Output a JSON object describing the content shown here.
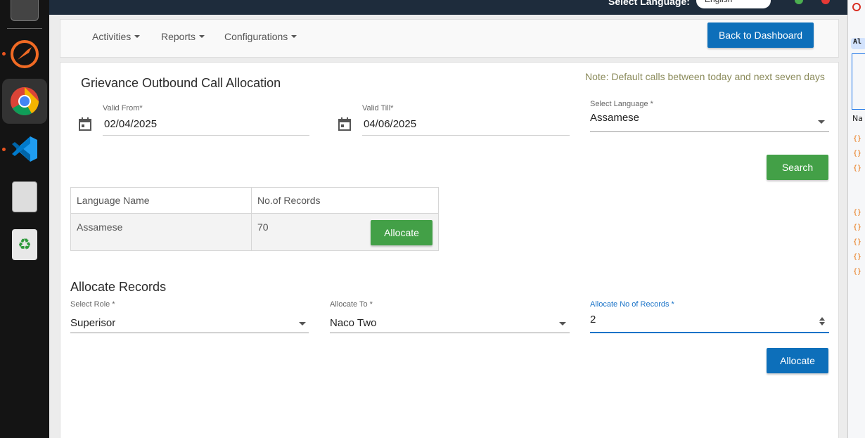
{
  "dock": {
    "apps": [
      {
        "name": "postman-icon"
      },
      {
        "name": "chrome-icon"
      },
      {
        "name": "vscode-icon"
      },
      {
        "name": "files-icon"
      },
      {
        "name": "trash-icon"
      }
    ]
  },
  "topbar": {
    "language_label": "Select Language:",
    "language_value": "English"
  },
  "nav": {
    "activities": "Activities",
    "reports": "Reports",
    "configurations": "Configurations",
    "back_button": "Back to Dashboard"
  },
  "page": {
    "title": "Grievance Outbound Call Allocation",
    "note": "Note: Default calls between today and next seven days"
  },
  "filters": {
    "valid_from_label": "Valid From*",
    "valid_from_value": "02/04/2025",
    "valid_till_label": "Valid Till*",
    "valid_till_value": "04/06/2025",
    "language_label": "Select Language *",
    "language_value": "Assamese",
    "search_button": "Search"
  },
  "table": {
    "headers": [
      "Language Name",
      "No.of Records"
    ],
    "rows": [
      {
        "language": "Assamese",
        "records": "70",
        "action": "Allocate"
      }
    ]
  },
  "allocate": {
    "section_title": "Allocate Records",
    "role_label": "Select Role *",
    "role_value": "Superisor",
    "to_label": "Allocate To *",
    "to_value": "Naco Two",
    "count_label": "Allocate No of Records *",
    "count_value": "2",
    "submit_button": "Allocate"
  },
  "colors": {
    "primary_blue": "#0d6fba",
    "success_green": "#43a047",
    "topbar": "#1e2c3c",
    "focus_blue": "#1a73c8"
  }
}
